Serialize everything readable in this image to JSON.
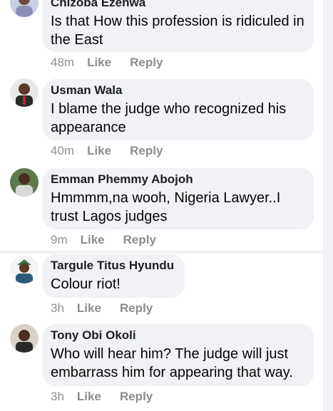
{
  "comments": [
    {
      "author": "Chizoba Ezenwa",
      "text": "Is that How this profession is ridiculed in the East",
      "time": "48m",
      "like": "Like",
      "reply": "Reply"
    },
    {
      "author": "Usman Wala",
      "text": "I blame the judge who recognized his appearance",
      "time": "40m",
      "like": "Like",
      "reply": "Reply"
    },
    {
      "author": "Emman Phemmy Abojoh",
      "text": "Hmmmm,na wooh, Nigeria Lawyer..I trust Lagos judges",
      "time": "9m",
      "like": "Like",
      "reply": "Reply"
    },
    {
      "author": "Targule Titus Hyundu",
      "text": "Colour riot!",
      "time": "3h",
      "like": "Like",
      "reply": "Reply"
    },
    {
      "author": "Tony Obi Okoli",
      "text": "Who will hear him? The judge will just embarrass him for appearing that way.",
      "time": "3h",
      "like": "Like",
      "reply": "Reply"
    }
  ]
}
